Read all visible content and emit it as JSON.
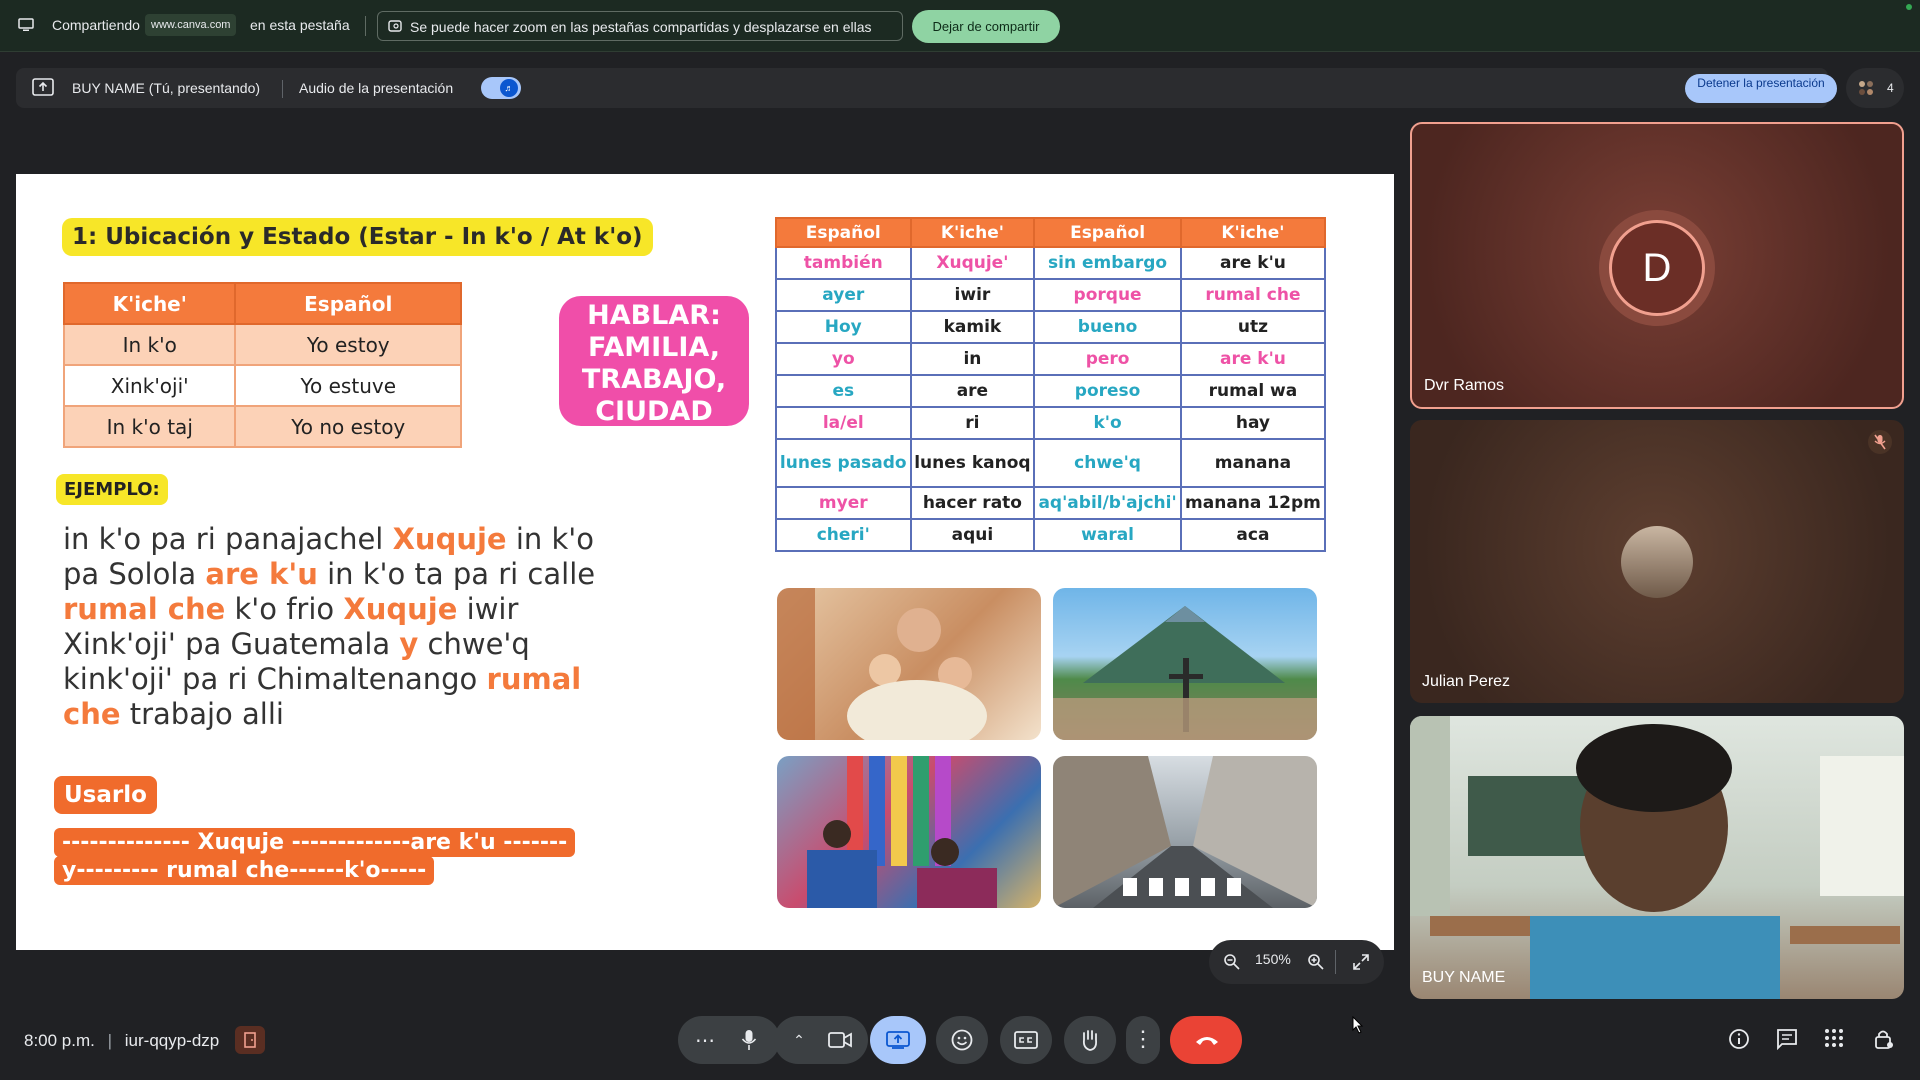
{
  "share_bar": {
    "sharing_label": "Compartiendo",
    "url": "www.canva.com",
    "tab_label": "en esta pestaña",
    "zoom_notice": "Se puede hacer zoom en las pestañas compartidas y desplazarse en ellas",
    "stop_sharing": "Dejar de compartir"
  },
  "present_bar": {
    "presenter": "BUY NAME (Tú, presentando)",
    "audio_label": "Audio de la presentación",
    "stop_presenting": "Detener la presentación",
    "people_count": "4"
  },
  "slide": {
    "title": "1: Ubicación y Estado (Estar - In k'o / At k'o)",
    "table1": {
      "headers": [
        "K'iche'",
        "Español"
      ],
      "rows": [
        [
          "In k'o",
          "Yo estoy"
        ],
        [
          "Xink'oji'",
          "Yo estuve"
        ],
        [
          "In k'o taj",
          "Yo no estoy"
        ]
      ]
    },
    "hablar": "HABLAR: FAMILIA, TRABAJO, CIUDAD",
    "ejemplo": "EJEMPLO:",
    "example": {
      "t1": "in k'o pa ri panajachel ",
      "h1": "Xuquje",
      "t2": " in k'o pa Solola ",
      "h2": "are k'u",
      "t3": " in k'o ta pa ri calle ",
      "h3": "rumal che",
      "t4": " k'o frio ",
      "h4": "Xuquje",
      "t5": " iwir Xink'oji' pa Guatemala ",
      "h5": "y",
      "t6": " chwe'q kink'oji' pa ri Chimaltenango ",
      "h6": "rumal che",
      "t7": " trabajo alli"
    },
    "usarlo": "Usarlo",
    "use_line1": "-------------- Xuquje -------------are k'u -------",
    "use_line2": "y--------- rumal che------k'o-----",
    "table2": {
      "headers": [
        "Español",
        "K'iche'",
        "Español",
        "K'iche'"
      ],
      "rows": [
        [
          "también",
          "Xuquje'",
          "sin embargo",
          "are k'u"
        ],
        [
          "ayer",
          "iwir",
          "porque",
          "rumal che"
        ],
        [
          "Hoy",
          "kamik",
          "bueno",
          "utz"
        ],
        [
          "yo",
          "in",
          "pero",
          "are k'u"
        ],
        [
          "es",
          "are",
          "poreso",
          "rumal wa"
        ],
        [
          "la/el",
          "ri",
          "k'o",
          "hay"
        ],
        [
          "lunes pasado",
          "lunes kanoq",
          "chwe'q",
          "manana"
        ],
        [
          "myer",
          "hacer rato",
          "aq'abil/b'ajchi'",
          "manana 12pm"
        ],
        [
          "cheri'",
          "aqui",
          "waral",
          "aca"
        ]
      ]
    }
  },
  "zoom": {
    "level": "150%"
  },
  "participants": [
    {
      "name": "Dvr Ramos",
      "initial": "D"
    },
    {
      "name": "Julian Perez"
    },
    {
      "name": "BUY NAME"
    }
  ],
  "bottom": {
    "time": "8:00 p.m.",
    "meeting_code": "iur-qqyp-dzp"
  },
  "colors": {
    "accent_orange": "#f47a3c",
    "accent_pink": "#f04ea9",
    "highlight_yellow": "#f7e628",
    "end_call_red": "#ea4335",
    "present_blue": "#a8c7fa"
  }
}
